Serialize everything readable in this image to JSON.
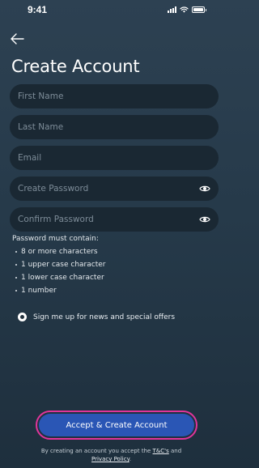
{
  "status_bar": {
    "time": "9:41"
  },
  "header": {
    "title": "Create Account"
  },
  "form": {
    "first_name": {
      "placeholder": "First Name",
      "value": ""
    },
    "last_name": {
      "placeholder": "Last Name",
      "value": ""
    },
    "email": {
      "placeholder": "Email",
      "value": ""
    },
    "create_password": {
      "placeholder": "Create Password",
      "value": ""
    },
    "confirm_password": {
      "placeholder": "Confirm Password",
      "value": ""
    }
  },
  "password_rules": {
    "title": "Password must contain:",
    "items": [
      "8 or more characters",
      "1 upper case character",
      "1 lower case character",
      "1 number"
    ]
  },
  "optin": {
    "label": "Sign me up for news and special offers",
    "selected": true
  },
  "cta": {
    "label": "Accept & Create Account"
  },
  "legal": {
    "prefix": "By creating an account you accept the",
    "tc_link": "T&C's",
    "and": "and",
    "privacy_link": "Privacy Policy",
    "suffix": "."
  },
  "colors": {
    "background": "#263a4a",
    "field": "#1a2833",
    "button": "#2a56b5",
    "button_outline": "#e0349a"
  },
  "icons": [
    "back-arrow-icon",
    "eye-icon",
    "signal-icon",
    "wifi-icon",
    "battery-icon"
  ]
}
